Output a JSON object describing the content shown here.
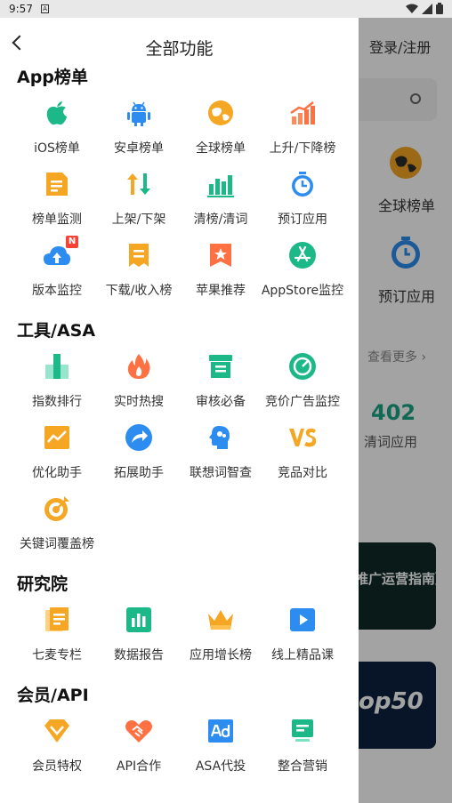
{
  "status": {
    "time": "9:57",
    "sim": "A"
  },
  "background": {
    "login": "登录/注册",
    "global_label": "全球榜单",
    "preorder_label": "预订应用",
    "more": "查看更多 ›",
    "stat_value": "402",
    "stat_label": "清词应用",
    "banner1_text": "推广运营指南》",
    "banner2_text": "op50"
  },
  "header": {
    "title": "全部功能"
  },
  "sections": [
    {
      "title": "App榜单",
      "items": [
        "iOS榜单",
        "安卓榜单",
        "全球榜单",
        "上升/下降榜",
        "榜单监测",
        "上架/下架",
        "清榜/清词",
        "预订应用",
        "版本监控",
        "下载/收入榜",
        "苹果推荐",
        "AppStore监控"
      ]
    },
    {
      "title": "工具/ASA",
      "items": [
        "指数排行",
        "实时热搜",
        "审核必备",
        "竞价广告监控",
        "优化助手",
        "拓展助手",
        "联想词智查",
        "竞品对比",
        "关键词覆盖榜"
      ]
    },
    {
      "title": "研究院",
      "items": [
        "七麦专栏",
        "数据报告",
        "应用增长榜",
        "线上精品课"
      ]
    },
    {
      "title": "会员/API",
      "items": [
        "会员特权",
        "API合作",
        "ASA代投",
        "整合营销"
      ]
    }
  ],
  "badge_new": "N"
}
